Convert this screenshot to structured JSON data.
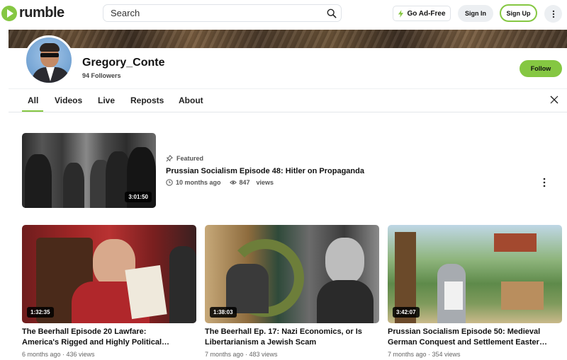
{
  "header": {
    "logo_text": "rumble",
    "search_placeholder": "Search",
    "go_adfree_label": "Go Ad-Free",
    "signin_label": "Sign In",
    "signup_label": "Sign Up"
  },
  "channel": {
    "name": "Gregory_Conte",
    "followers": "94 Followers",
    "follow_label": "Follow"
  },
  "tabs": [
    {
      "label": "All",
      "active": true
    },
    {
      "label": "Videos"
    },
    {
      "label": "Live"
    },
    {
      "label": "Reposts"
    },
    {
      "label": "About"
    }
  ],
  "featured": {
    "label": "Featured",
    "title": "Prussian Socialism Episode 48: Hitler on Propaganda",
    "age": "10 months ago",
    "views": "847",
    "views_suffix": "views",
    "duration": "3:01:50"
  },
  "videos": [
    {
      "duration": "1:32:35",
      "title_line1": "The Beerhall Episode 20 Lawfare:",
      "title_line2": "America's Rigged and Highly Political…",
      "meta": "6 months ago · 436 views"
    },
    {
      "duration": "1:38:03",
      "title_line1": "The Beerhall Ep. 17: Nazi Economics, or Is",
      "title_line2": "Libertarianism a Jewish Scam",
      "meta": "7 months ago · 483 views"
    },
    {
      "duration": "3:42:07",
      "title_line1": "Prussian Socialism Episode 50: Medieval",
      "title_line2": "German Conquest and Settlement Easter…",
      "meta": "7 months ago · 354 views"
    }
  ],
  "colors": {
    "accent": "#85c742",
    "text": "#111111",
    "muted": "#666666"
  }
}
